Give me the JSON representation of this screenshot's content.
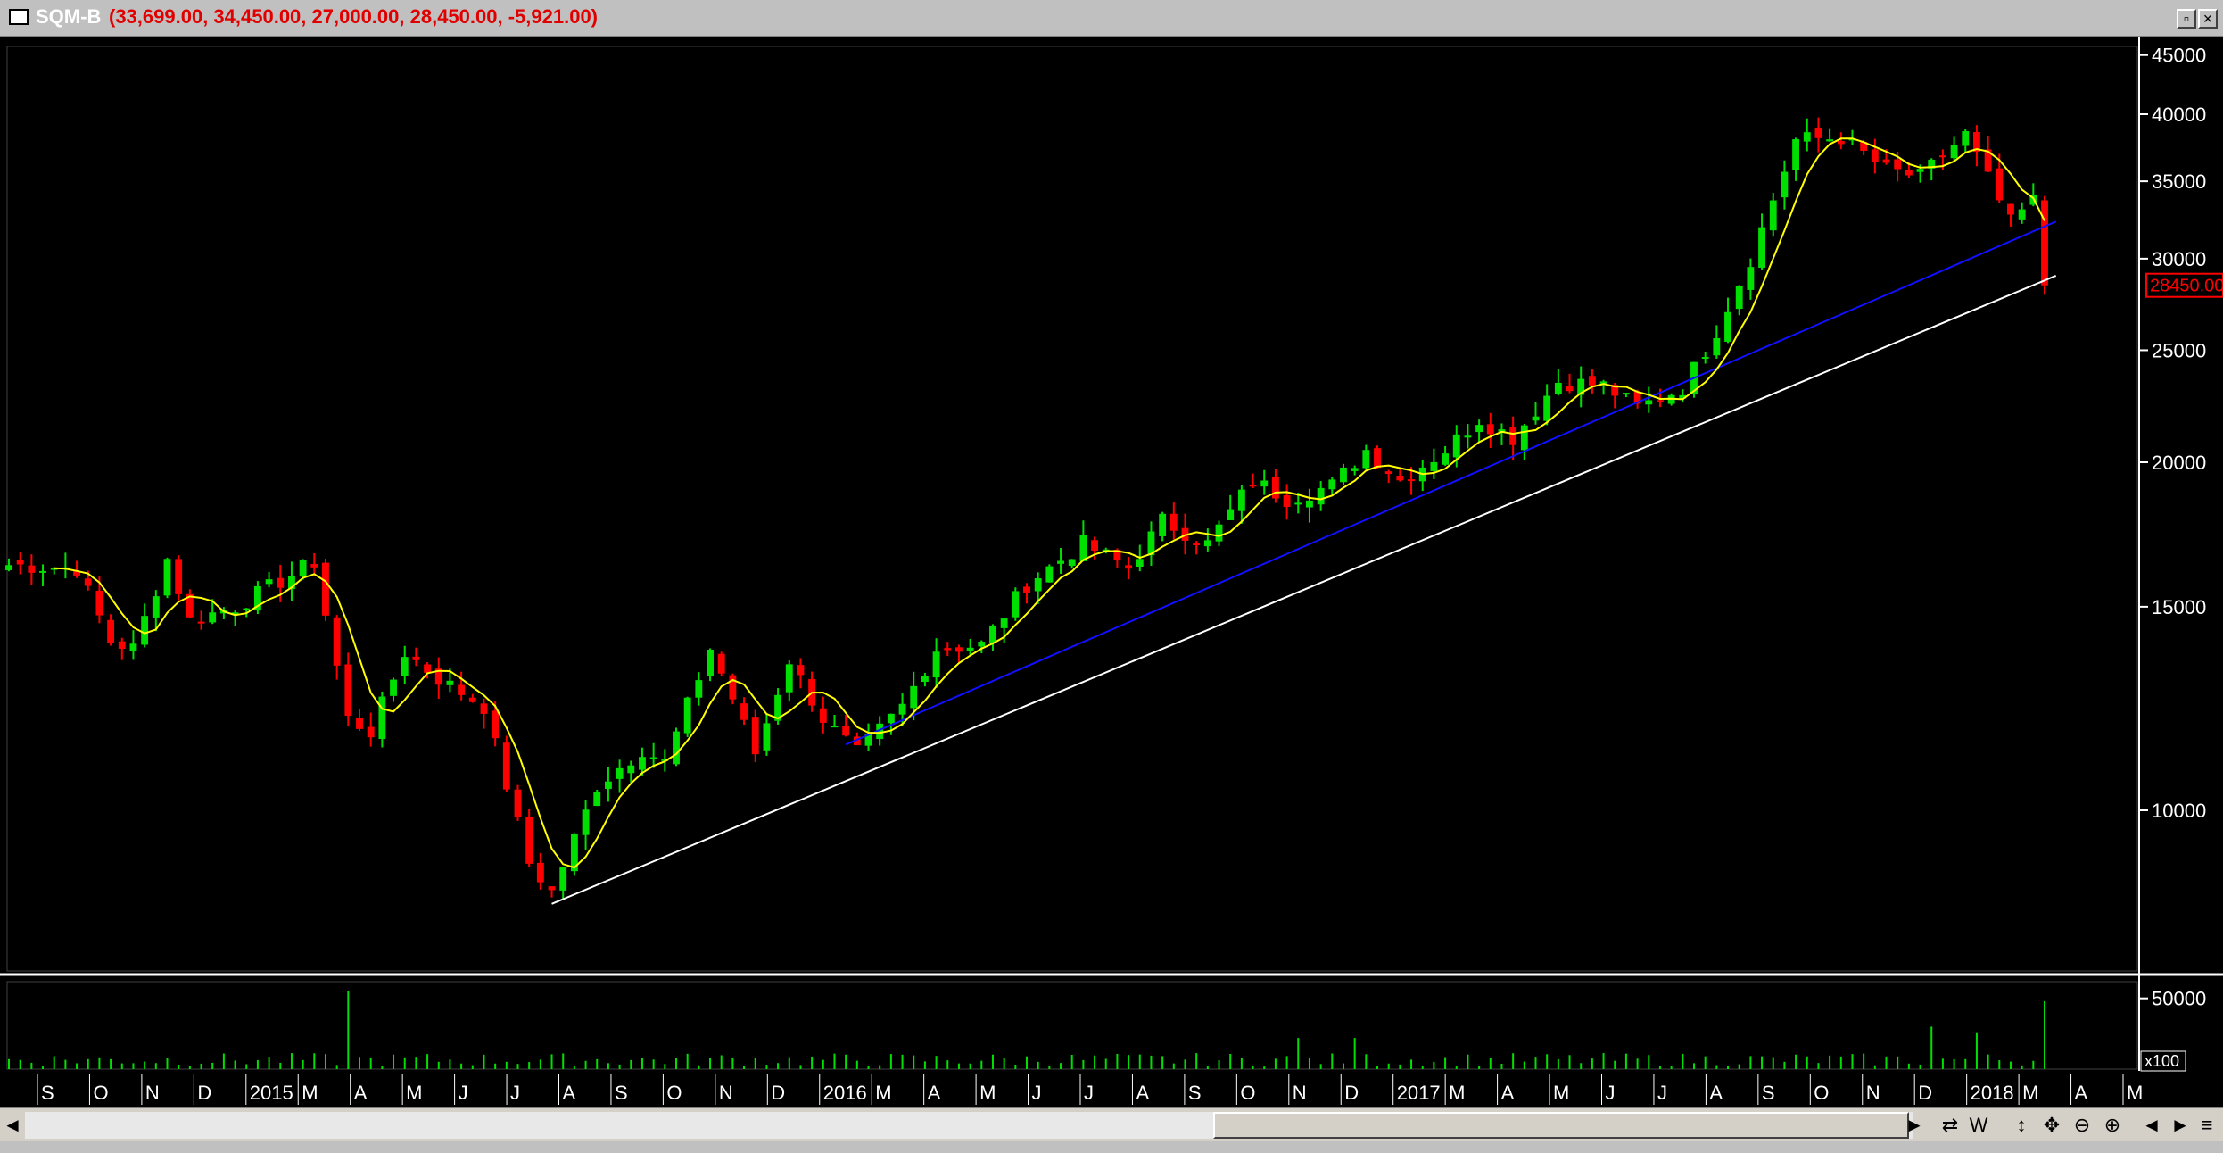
{
  "window": {
    "symbol": "SQM-B",
    "ohlc_text": "(33,699.00, 34,450.00, 27,000.00, 28,450.00, -5,921.00)",
    "last_price_tag": "28450.00",
    "volume_multiplier": "x100"
  },
  "colors": {
    "background": "#000000",
    "up_candle": "#00e000",
    "down_candle": "#ff0000",
    "moving_average": "#ffff00",
    "trendline_upper": "#1010ff",
    "trendline_lower": "#ffffff",
    "volume_bars": "#00e000"
  },
  "axis": {
    "price_ticks": [
      "45000",
      "40000",
      "35000",
      "30000",
      "25000",
      "20000",
      "15000",
      "10000"
    ],
    "price_scale": "log",
    "volume_ticks": [
      "50000"
    ],
    "month_labels": [
      "S",
      "O",
      "N",
      "D",
      "2015",
      "M",
      "A",
      "M",
      "J",
      "J",
      "A",
      "S",
      "O",
      "N",
      "D",
      "2016",
      "M",
      "A",
      "M",
      "J",
      "J",
      "A",
      "S",
      "O",
      "N",
      "D",
      "2017",
      "M",
      "A",
      "M",
      "J",
      "J",
      "A",
      "S",
      "O",
      "N",
      "D",
      "2018",
      "M",
      "A",
      "M"
    ]
  },
  "toolbar": {
    "scroll_left_icon": "◄",
    "scroll_right_icon": "►",
    "icons": [
      "cycle-icon",
      "weekly-icon",
      "move-vertical-icon",
      "move-icon",
      "zoom-out-icon",
      "zoom-in-icon",
      "prev-icon",
      "next-icon",
      "menu-icon"
    ],
    "weekly_label": "W"
  },
  "chart_data": {
    "type": "candlestick",
    "period": "weekly",
    "price_range": [
      8000,
      46000
    ],
    "anchors": [
      {
        "week": 0,
        "price": 16300
      },
      {
        "week": 6,
        "price": 16200
      },
      {
        "week": 9,
        "price": 14000
      },
      {
        "week": 11,
        "price": 13800
      },
      {
        "week": 14,
        "price": 16500
      },
      {
        "week": 16,
        "price": 14600
      },
      {
        "week": 20,
        "price": 15000
      },
      {
        "week": 27,
        "price": 16400
      },
      {
        "week": 30,
        "price": 12000
      },
      {
        "week": 32,
        "price": 11700
      },
      {
        "week": 35,
        "price": 13700
      },
      {
        "week": 38,
        "price": 13000
      },
      {
        "week": 42,
        "price": 12300
      },
      {
        "week": 46,
        "price": 9000
      },
      {
        "week": 48,
        "price": 8500
      },
      {
        "week": 52,
        "price": 10500
      },
      {
        "week": 56,
        "price": 11300
      },
      {
        "week": 58,
        "price": 11000
      },
      {
        "week": 62,
        "price": 13800
      },
      {
        "week": 64,
        "price": 12500
      },
      {
        "week": 66,
        "price": 11200
      },
      {
        "week": 69,
        "price": 13500
      },
      {
        "week": 72,
        "price": 12000
      },
      {
        "week": 75,
        "price": 11200
      },
      {
        "week": 79,
        "price": 12300
      },
      {
        "week": 82,
        "price": 13800
      },
      {
        "week": 86,
        "price": 13900
      },
      {
        "week": 90,
        "price": 15700
      },
      {
        "week": 95,
        "price": 17000
      },
      {
        "week": 99,
        "price": 16200
      },
      {
        "week": 102,
        "price": 17800
      },
      {
        "week": 106,
        "price": 17000
      },
      {
        "week": 110,
        "price": 19300
      },
      {
        "week": 113,
        "price": 18600
      },
      {
        "week": 117,
        "price": 19100
      },
      {
        "week": 120,
        "price": 20500
      },
      {
        "week": 123,
        "price": 19300
      },
      {
        "week": 127,
        "price": 20500
      },
      {
        "week": 130,
        "price": 21800
      },
      {
        "week": 133,
        "price": 21000
      },
      {
        "week": 137,
        "price": 23500
      },
      {
        "week": 141,
        "price": 23300
      },
      {
        "week": 144,
        "price": 22300
      },
      {
        "week": 148,
        "price": 23200
      },
      {
        "week": 151,
        "price": 26000
      },
      {
        "week": 154,
        "price": 30000
      },
      {
        "week": 158,
        "price": 38000
      },
      {
        "week": 162,
        "price": 38200
      },
      {
        "week": 166,
        "price": 35800
      },
      {
        "week": 169,
        "price": 35300
      },
      {
        "week": 173,
        "price": 38400
      },
      {
        "week": 177,
        "price": 32200
      },
      {
        "week": 179,
        "price": 33700
      },
      {
        "week": 180,
        "price": 28450
      }
    ],
    "weeks_total": 181,
    "last_close": 28450,
    "volume_spikes": [
      {
        "week": 30,
        "volume": 55000
      },
      {
        "week": 114,
        "volume": 22000
      },
      {
        "week": 119,
        "volume": 22000
      },
      {
        "week": 170,
        "volume": 30000
      },
      {
        "week": 174,
        "volume": 26000
      },
      {
        "week": 180,
        "volume": 48000
      }
    ],
    "volume_base": 6000,
    "moving_average": true,
    "trendlines": [
      {
        "name": "white",
        "from": {
          "week": 48,
          "price": 8300
        },
        "to": {
          "week": 181,
          "price": 29000
        }
      },
      {
        "name": "blue",
        "from": {
          "week": 74,
          "price": 11400
        },
        "to": {
          "week": 181,
          "price": 32300
        }
      }
    ]
  }
}
